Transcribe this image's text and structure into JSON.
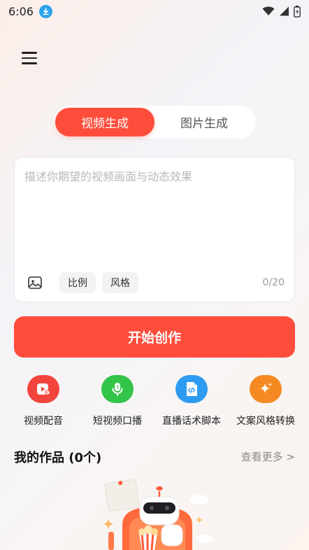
{
  "status": {
    "time": "6:06"
  },
  "mode_tabs": [
    {
      "label": "视频生成",
      "active": true
    },
    {
      "label": "图片生成",
      "active": false
    }
  ],
  "prompt": {
    "placeholder": "描述你期望的视频画面与动态效果",
    "value": "",
    "counter": "0/20"
  },
  "chips": {
    "ratio": "比例",
    "style": "风格"
  },
  "start_button": {
    "label": "开始创作"
  },
  "tools": [
    {
      "label": "视频配音",
      "icon": "video-dub-icon",
      "color": "#f2453d"
    },
    {
      "label": "短视频口播",
      "icon": "microphone-icon",
      "color": "#33c44a"
    },
    {
      "label": "直播话术脚本",
      "icon": "script-file-icon",
      "color": "#2e9bf0"
    },
    {
      "label": "文案风格转换",
      "icon": "sparkle-icon",
      "color": "#f58a23"
    }
  ],
  "works": {
    "title": "我的作品 (0个)",
    "see_more": "查看更多 >"
  },
  "colors": {
    "accent": "#ff4d3c"
  }
}
